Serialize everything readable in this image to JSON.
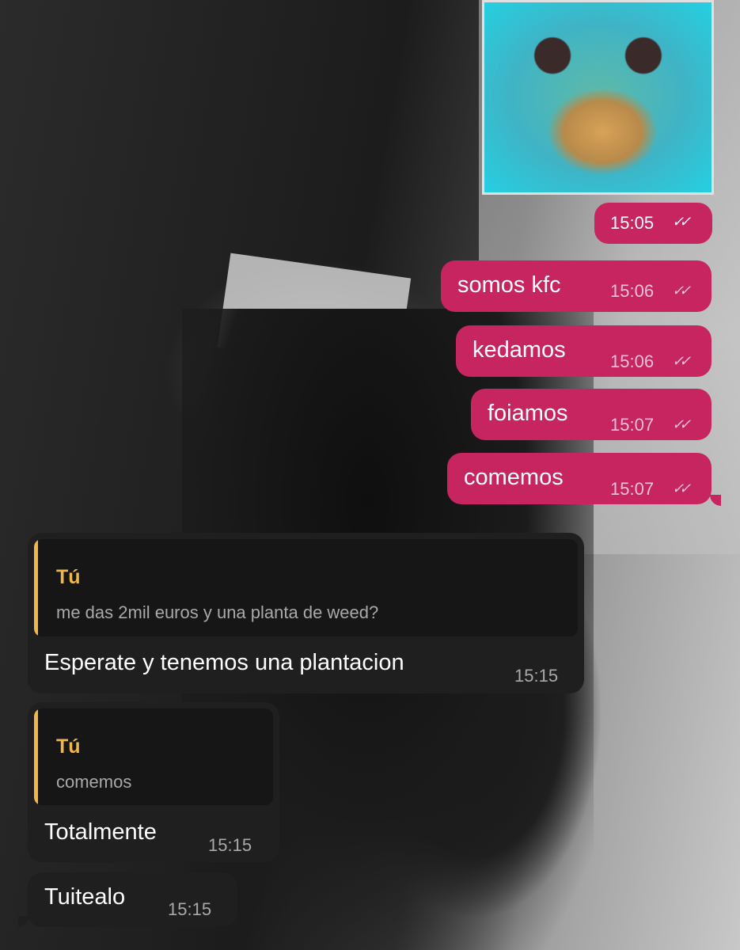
{
  "sticker": {
    "description_icon": "sticker-icon"
  },
  "colors": {
    "outgoing": "#c7255f",
    "incoming": "#1f1f1f",
    "quote_accent": "#f0b64a"
  },
  "outgoing": [
    {
      "text": "",
      "time": "15:05"
    },
    {
      "text": "somos kfc",
      "time": "15:06"
    },
    {
      "text": "kedamos",
      "time": "15:06"
    },
    {
      "text": "foiamos",
      "time": "15:07"
    },
    {
      "text": "comemos",
      "time": "15:07"
    }
  ],
  "incoming": [
    {
      "quote_author": "Tú",
      "quote_text": "me das 2mil euros y una planta de weed?",
      "text": "Esperate y tenemos una plantacion",
      "time": "15:15"
    },
    {
      "quote_author": "Tú",
      "quote_text": "comemos",
      "text": "Totalmente",
      "time": "15:15"
    },
    {
      "text": "Tuitealo",
      "time": "15:15"
    }
  ]
}
